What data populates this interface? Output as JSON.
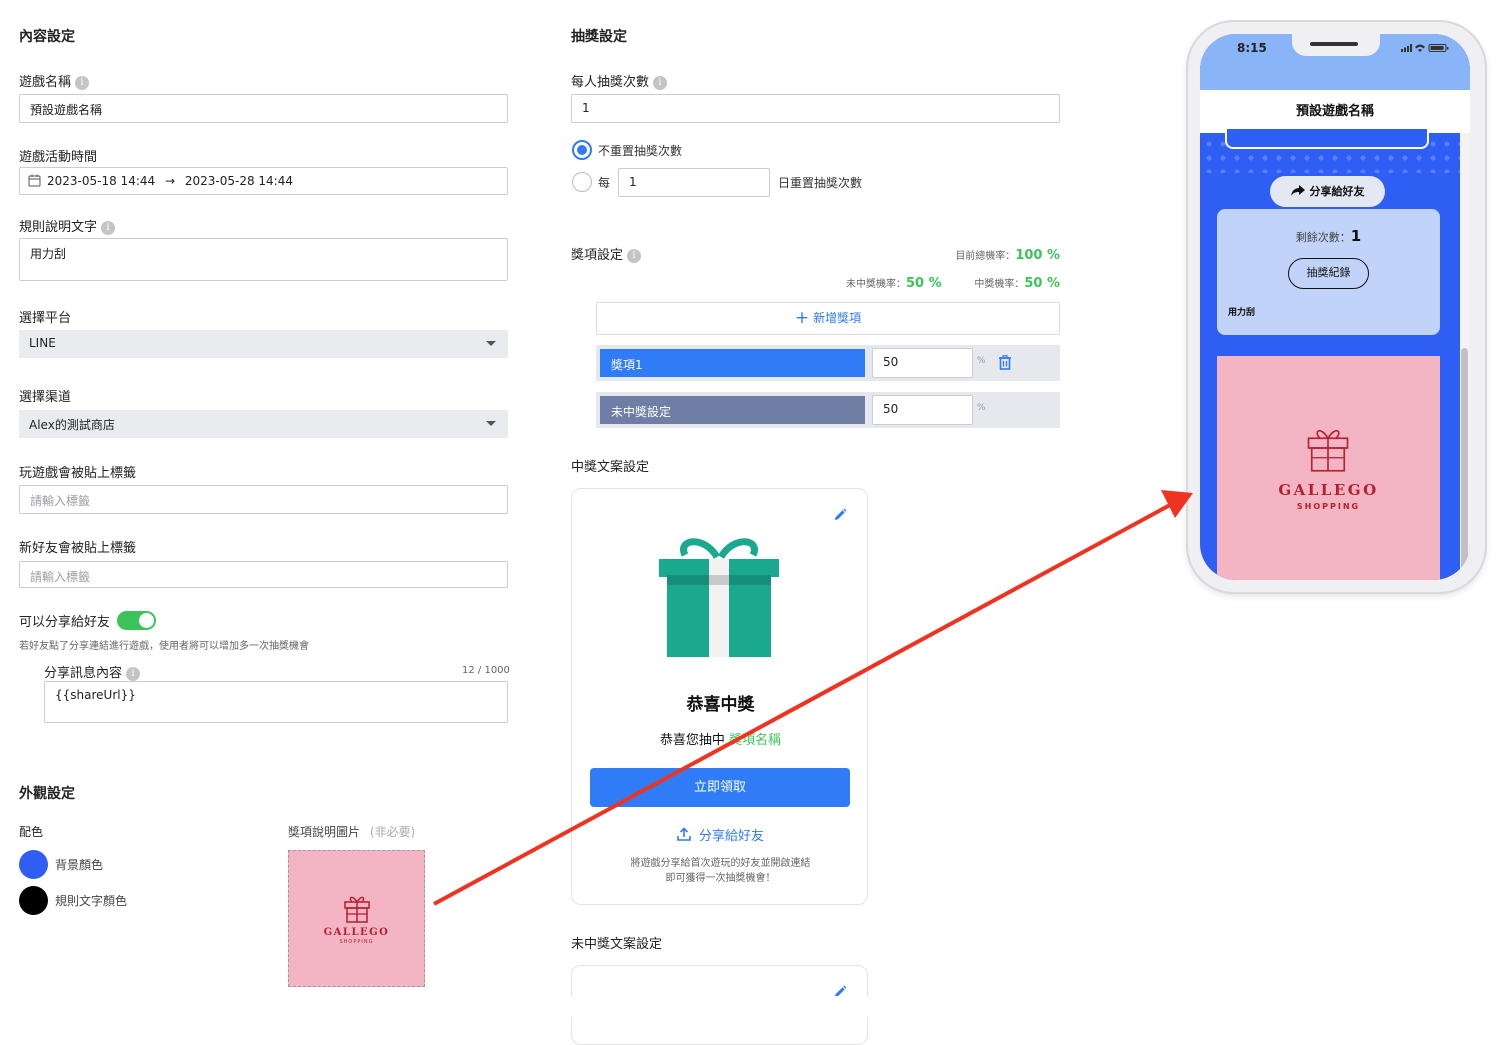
{
  "content": {
    "section_title": "內容設定",
    "game_name": {
      "label": "遊戲名稱",
      "value": "預設遊戲名稱"
    },
    "game_time": {
      "label": "遊戲活動時間",
      "start": "2023-05-18 14:44",
      "arrow": "→",
      "end": "2023-05-28 14:44"
    },
    "rule_text": {
      "label": "規則說明文字",
      "value": "用力刮"
    },
    "platform": {
      "label": "選擇平台",
      "value": "LINE"
    },
    "channel": {
      "label": "選擇渠道",
      "value": "Alex的測試商店"
    },
    "play_tag": {
      "label": "玩遊戲會被貼上標籤",
      "placeholder": "請輸入標籤"
    },
    "friend_tag": {
      "label": "新好友會被貼上標籤",
      "placeholder": "請輸入標籤"
    },
    "share": {
      "label": "可以分享給好友",
      "enabled": true,
      "hint": "若好友點了分享連結進行遊戲，使用者將可以增加多一次抽獎機會",
      "message_label": "分享訊息內容",
      "counter": "12 / 1000",
      "message_value": "{{shareUrl}}"
    }
  },
  "appearance": {
    "section_title": "外觀設定",
    "color_label": "配色",
    "bg_color": {
      "label": "背景顏色",
      "color": "#2f5ef5"
    },
    "rule_color": {
      "label": "規則文字顏色",
      "color": "#000000"
    },
    "prize_image": {
      "label": "獎項說明圖片",
      "optional": "(非必要)"
    }
  },
  "lottery": {
    "section_title": "抽獎設定",
    "times_label": "每人抽獎次數",
    "times_value": "1",
    "reset_none_label": "不重置抽獎次數",
    "reset_every_prefix": "每",
    "reset_every_value": "1",
    "reset_every_suffix": "日重置抽獎次數"
  },
  "prizes": {
    "title": "獎項設定",
    "total_rate_label": "目前總機率：",
    "total_rate": "100 %",
    "no_win_rate_label": "未中獎機率：",
    "no_win_rate": "50 %",
    "win_rate_label": "中獎機率：",
    "win_rate": "50 %",
    "add_label": "新增獎項",
    "items": [
      {
        "name": "獎項1",
        "percent": "50",
        "unit": "%"
      },
      {
        "name": "未中獎設定",
        "percent": "50",
        "unit": "%"
      }
    ]
  },
  "win_copy": {
    "section_title": "中獎文案設定",
    "heading": "恭喜中獎",
    "line_prefix": "恭喜您抽中",
    "prize_name": "獎項名稱",
    "claim_button": "立即領取",
    "share_button": "分享給好友",
    "note_line1": "將遊戲分享給首次遊玩的好友並開啟連結",
    "note_line2": "即可獲得一次抽獎機會！"
  },
  "lose_copy": {
    "section_title": "未中獎文案設定"
  },
  "phone": {
    "time": "8:15",
    "title": "預設遊戲名稱",
    "share_button": "分享給好友",
    "remaining_label": "剩餘次數：",
    "remaining_value": "1",
    "history_button": "抽獎紀錄",
    "rule_text": "用力刮"
  },
  "logo": {
    "brand": "GALLEGO",
    "sub": "SHOPPING",
    "bg": "#f3b4c3",
    "fg": "#b51f2e"
  },
  "colors": {
    "accent": "#2f7cf6",
    "green": "#3cc45a",
    "arrow": "#f03320"
  }
}
